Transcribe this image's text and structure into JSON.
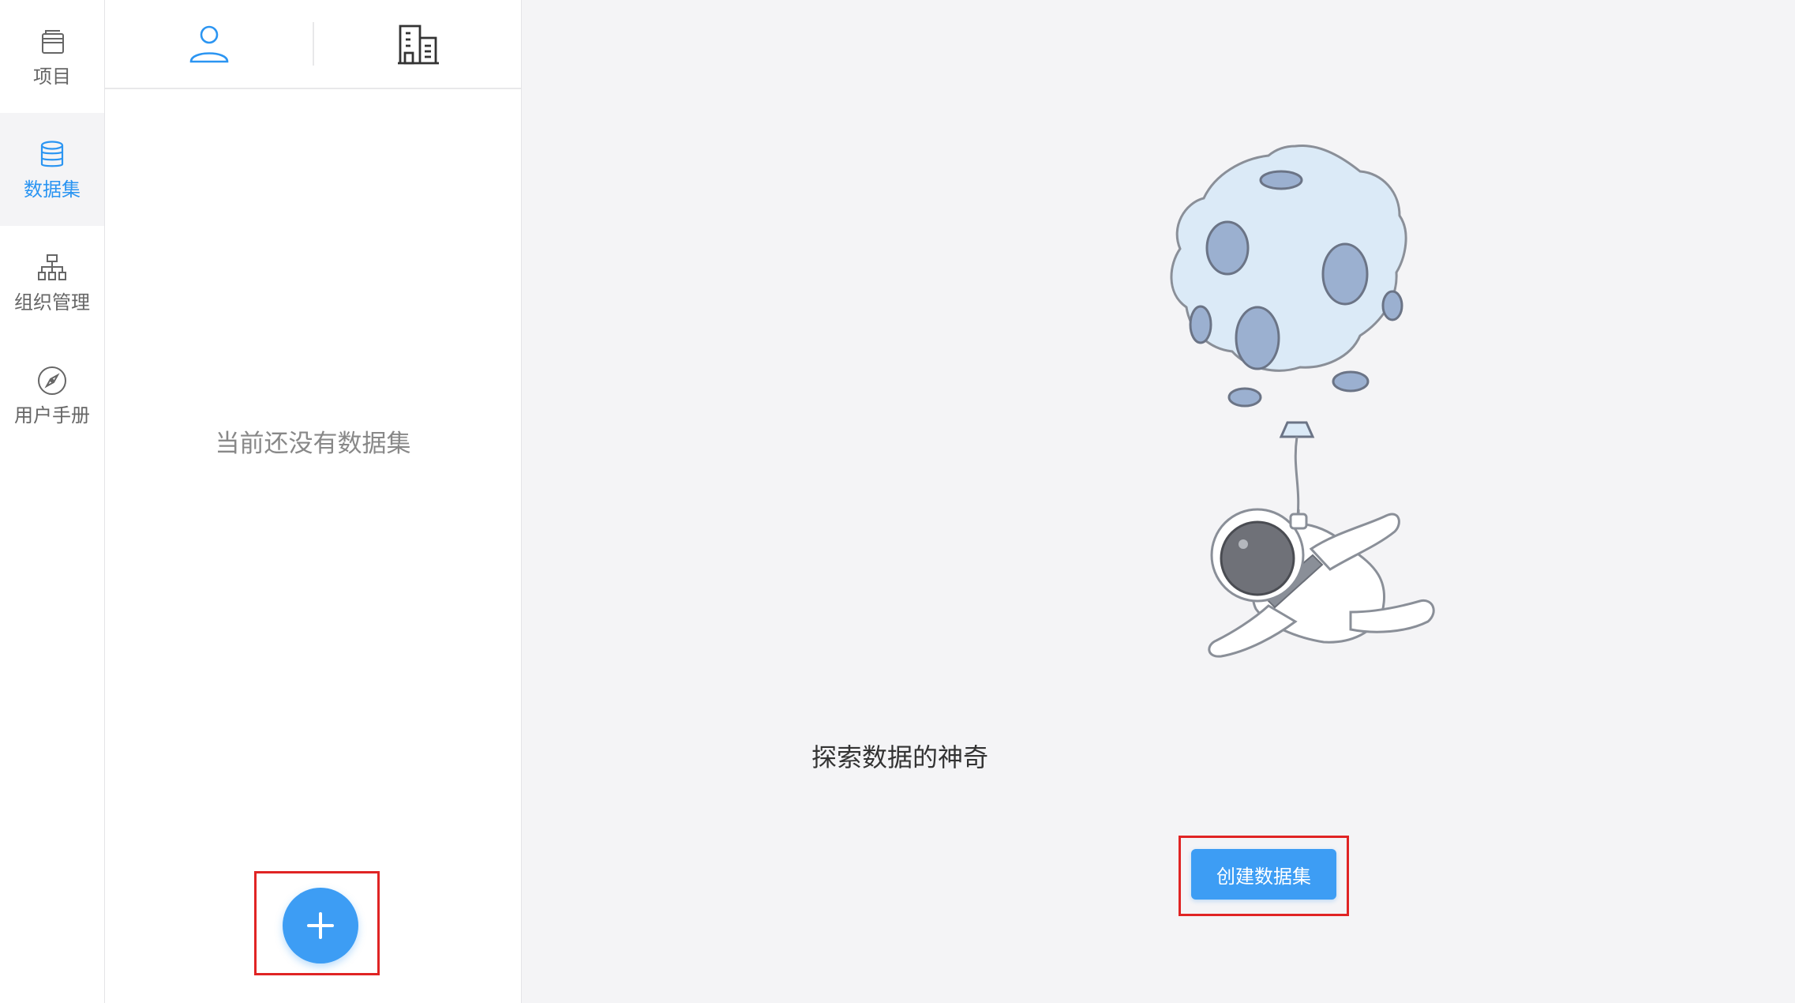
{
  "sidebar": {
    "items": [
      {
        "label": "项目",
        "icon": "window-stack-icon",
        "active": false
      },
      {
        "label": "数据集",
        "icon": "database-icon",
        "active": true
      },
      {
        "label": "组织管理",
        "icon": "org-chart-icon",
        "active": false
      },
      {
        "label": "用户手册",
        "icon": "compass-icon",
        "active": false
      }
    ]
  },
  "panel": {
    "tabs": [
      {
        "icon": "user-icon",
        "active": true
      },
      {
        "icon": "building-icon",
        "active": false
      }
    ],
    "empty_text": "当前还没有数据集",
    "add_icon": "plus-icon"
  },
  "main": {
    "illustration": "astronaut-balloon-moon-illustration",
    "headline": "探索数据的神奇",
    "create_button": "创建数据集"
  },
  "colors": {
    "accent": "#3d9df4",
    "highlight": "#e02424",
    "background": "#f4f4f6",
    "text_muted": "#888888"
  }
}
